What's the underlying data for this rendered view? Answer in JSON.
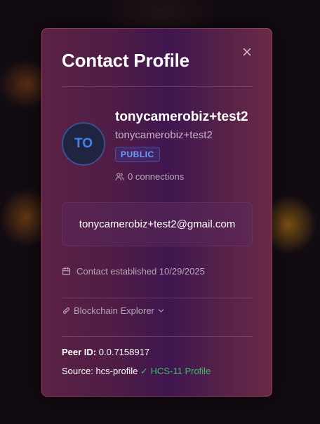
{
  "modal": {
    "title": "Contact Profile",
    "close_icon": "close-icon"
  },
  "profile": {
    "avatar_initials": "TO",
    "display_name": "tonycamerobiz+test2",
    "handle": "tonycamerobiz+test2",
    "visibility_badge": "PUBLIC",
    "connections_text": "0 connections"
  },
  "email": "tonycamerobiz+test2@gmail.com",
  "established_text": "Contact established 10/29/2025",
  "explorer": {
    "label": "Blockchain Explorer",
    "icon": "link-icon"
  },
  "peer": {
    "label": "Peer ID:",
    "value": "0.0.7158917"
  },
  "source": {
    "label": "Source:",
    "value": "hcs-profile",
    "check": "✓",
    "verified_text": "HCS-11 Profile"
  },
  "colors": {
    "accent_blue": "#3c82f0",
    "verified_green": "#3fb86a"
  }
}
